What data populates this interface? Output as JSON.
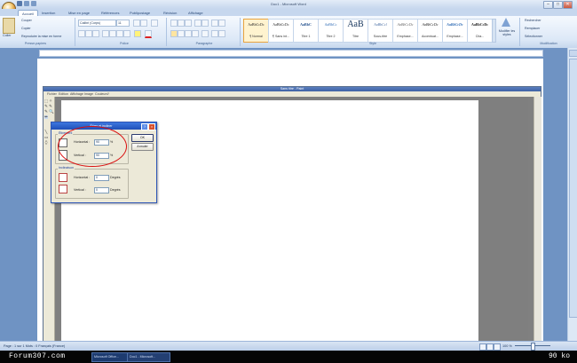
{
  "window": {
    "title": "Doc1 - Microsoft Word",
    "buttons": [
      "–",
      "□",
      "✕"
    ]
  },
  "ribbon": {
    "tabs": [
      "Accueil",
      "Insertion",
      "Mise en page",
      "Références",
      "Publipostage",
      "Révision",
      "Affichage"
    ],
    "clipboard": {
      "paste": "Coller",
      "cut": "Couper",
      "copy": "Copier",
      "format": "Reproduire la mise en forme",
      "group": "Presse-papiers"
    },
    "font": {
      "family": "Calibri (Corps)",
      "size": "11",
      "group": "Police"
    },
    "paragraph": {
      "group": "Paragraphe"
    },
    "styles": {
      "group": "Style",
      "items": [
        {
          "sample": "AaBbCcDc",
          "name": "¶ Normal"
        },
        {
          "sample": "AaBbCcDc",
          "name": "¶ Sans int..."
        },
        {
          "sample": "AaBbC",
          "name": "Titre 1"
        },
        {
          "sample": "AaBbCc",
          "name": "Titre 2"
        },
        {
          "sample": "AaB",
          "name": "Titre"
        },
        {
          "sample": "AaBbCcl",
          "name": "Sous-titre"
        },
        {
          "sample": "AaBbCcDc",
          "name": "Emphase..."
        },
        {
          "sample": "AaBbCcDc",
          "name": "Accentuat..."
        },
        {
          "sample": "AaBbCcDc",
          "name": "Emphase..."
        },
        {
          "sample": "AaBbCcDc",
          "name": "Cita..."
        }
      ],
      "change": "Modifier les styles"
    },
    "editing": {
      "find": "Rechercher",
      "replace": "Remplacer",
      "select": "Sélectionner",
      "group": "Modification"
    }
  },
  "paint": {
    "title": "Sans titre - Paint",
    "menu": [
      "Fichier",
      "Edition",
      "Affichage",
      "Image",
      "Couleurs",
      "?"
    ],
    "tools": [
      "⬚",
      "✧",
      "✎",
      "🔍",
      "✏",
      "🖌",
      "A",
      "╲",
      "▭",
      "⬯"
    ]
  },
  "dialog": {
    "title": "Étirer et incliner",
    "stretch": {
      "legend": "Étirement",
      "horizontal_label": "Horizontal :",
      "horizontal_value": "90",
      "vertical_label": "Vertical :",
      "vertical_value": "90",
      "unit": "%"
    },
    "skew": {
      "legend": "Inclinaison",
      "horizontal_label": "Horizontal :",
      "horizontal_value": "0",
      "horizontal_unit": "Degrés",
      "vertical_label": "Vertical :",
      "vertical_value": "0",
      "vertical_unit": "Degrés"
    },
    "ok": "OK",
    "cancel": "Annuler"
  },
  "statusbar": {
    "left": "Page : 1 sur 1   Mots : 0   Français (France)",
    "zoom": "100 %"
  },
  "taskbar": {
    "forum": "Forum307.com",
    "item_a": "Microsoft Office...",
    "item_b": "Doc1 - Microsoft...",
    "size": "90 ko"
  }
}
